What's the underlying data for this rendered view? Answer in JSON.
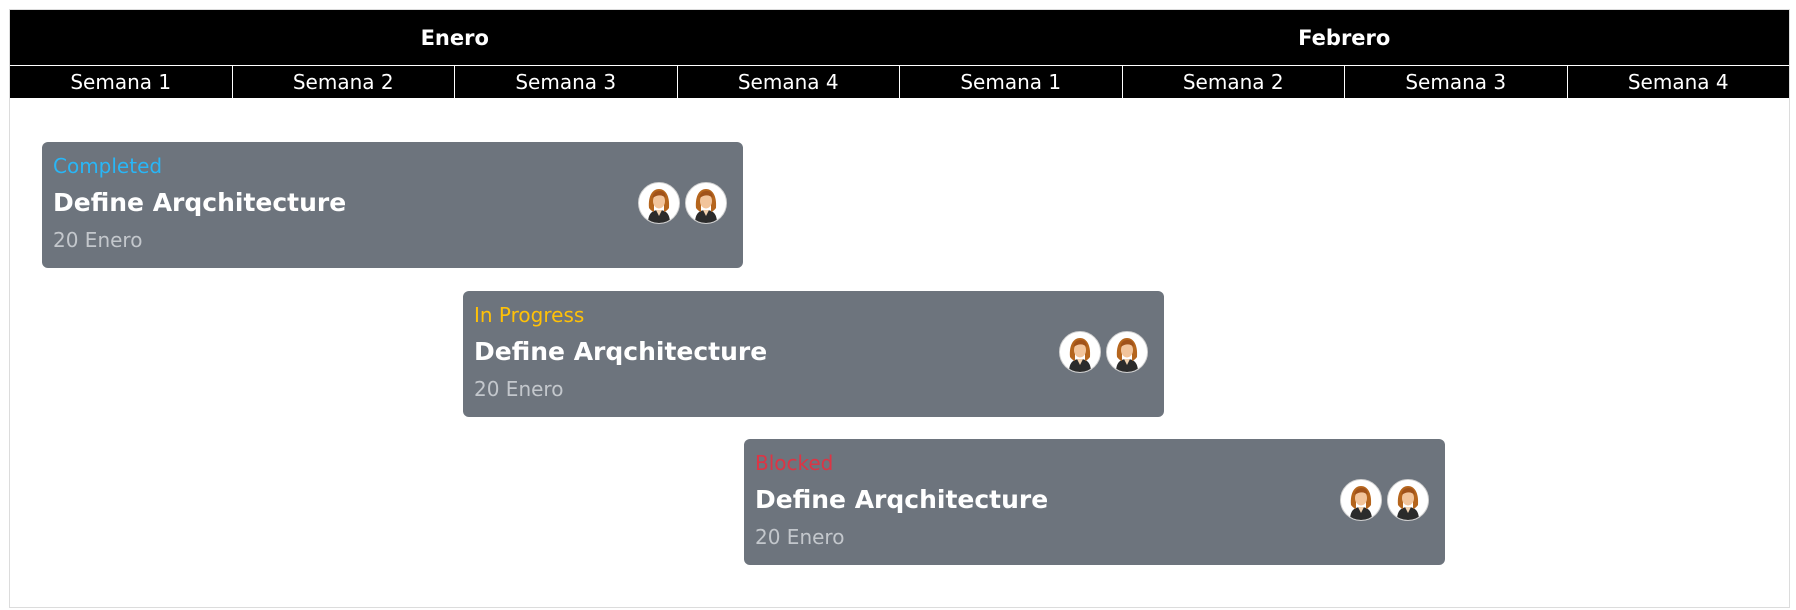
{
  "header": {
    "months": [
      "Enero",
      "Febrero"
    ],
    "weeks": [
      "Semana 1",
      "Semana 2",
      "Semana 3",
      "Semana 4",
      "Semana 1",
      "Semana 2",
      "Semana 3",
      "Semana 4"
    ]
  },
  "tasks": [
    {
      "status": "Completed",
      "status_color": "#29b6f6",
      "title": "Define Arqchitecture",
      "date": "20 Enero",
      "avatars": [
        "person-avatar",
        "person-avatar"
      ]
    },
    {
      "status": "In Progress",
      "status_color": "#ffc107",
      "title": "Define Arqchitecture",
      "date": "20 Enero",
      "avatars": [
        "person-avatar",
        "person-avatar"
      ]
    },
    {
      "status": "Blocked",
      "status_color": "#dc3545",
      "title": "Define Arqchitecture",
      "date": "20 Enero",
      "avatars": [
        "person-avatar",
        "person-avatar"
      ]
    }
  ],
  "colors": {
    "header_bg": "#000000",
    "card_bg": "#6d747d",
    "title_text": "#ffffff",
    "date_text": "#c3c7cc"
  }
}
